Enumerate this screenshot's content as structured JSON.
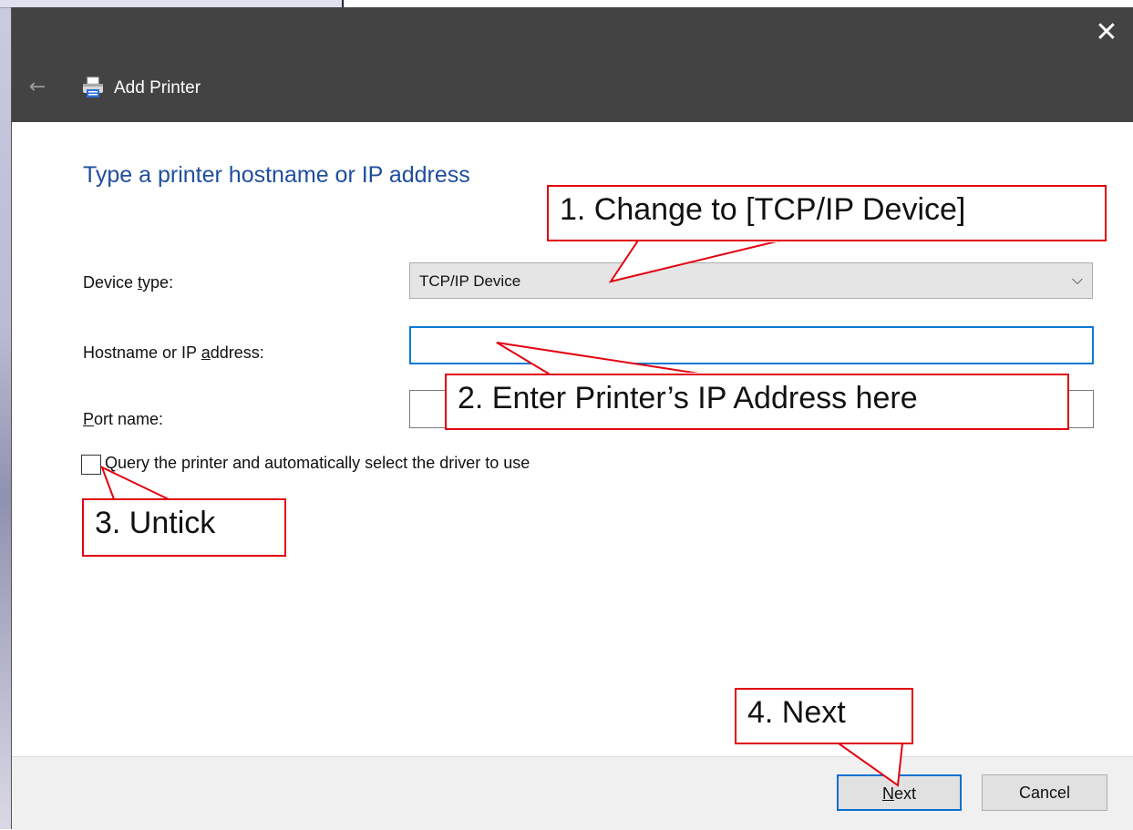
{
  "window": {
    "title": "Add Printer",
    "close_symbol": "✕",
    "back_symbol": "←"
  },
  "page": {
    "heading": "Type a printer hostname or IP address"
  },
  "form": {
    "device_type": {
      "label_pre": "Device ",
      "label_accel": "t",
      "label_post": "ype:",
      "value": "TCP/IP Device",
      "chevron": "⌵"
    },
    "hostname": {
      "label_pre": "Hostname or IP ",
      "label_accel": "a",
      "label_post": "ddress:",
      "value": ""
    },
    "port": {
      "label_accel": "P",
      "label_post": "ort name:",
      "value": ""
    },
    "query_checkbox": {
      "checked": false,
      "label_accel": "Q",
      "label_post": "uery the printer and automatically select the driver to use"
    }
  },
  "footer": {
    "next_accel": "N",
    "next_post": "ext",
    "cancel_label": "Cancel"
  },
  "annotations": {
    "step1": "1. Change to [TCP/IP Device]",
    "step2": "2. Enter Printer’s IP Address here",
    "step3": "3. Untick",
    "step4": "4. Next",
    "color": "#e3000f"
  },
  "icons": {
    "printer": "printer-icon",
    "back": "back-arrow-icon",
    "close": "close-icon",
    "chevron": "chevron-down-icon"
  }
}
